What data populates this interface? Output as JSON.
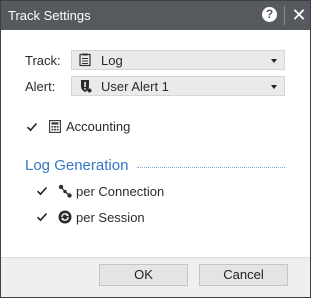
{
  "window": {
    "title": "Track Settings",
    "help_label": "?",
    "close_label": "✕"
  },
  "track": {
    "label": "Track:",
    "value": "Log",
    "icon": "log-document-icon"
  },
  "alert": {
    "label": "Alert:",
    "value": "User Alert 1",
    "icon": "alert-shield-icon"
  },
  "accounting": {
    "label": "Accounting",
    "checked": true,
    "icon": "calculator-icon"
  },
  "log_generation": {
    "title": "Log Generation",
    "per_connection": {
      "label": "per Connection",
      "checked": true,
      "icon": "connection-nodes-icon"
    },
    "per_session": {
      "label": "per Session",
      "checked": true,
      "icon": "session-sync-icon"
    }
  },
  "buttons": {
    "ok": "OK",
    "cancel": "Cancel"
  },
  "colors": {
    "titlebar": "#565a5f",
    "section_title": "#3477c6",
    "footer": "#efefef"
  }
}
